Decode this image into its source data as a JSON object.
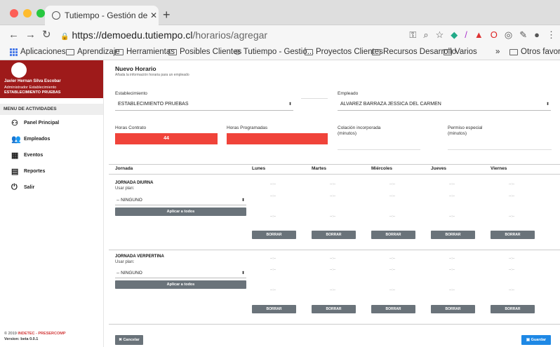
{
  "browser": {
    "tab_title": "Tutiempo - Gestión de Asistencia",
    "url_host": "https://demoedu.tutiempo.cl",
    "url_path": "/horarios/agregar",
    "bookmarks": [
      "Aplicaciones",
      "Aprendizaje",
      "Herramientas",
      "Posibles Clientes",
      "Tutiempo - Gestió...",
      "Proyectos Clientes",
      "Recursos Desarrollo",
      "Varios",
      "»",
      "Otros favoritos"
    ]
  },
  "sidebar": {
    "user_name": "Javier Hernan Silva Escobar",
    "user_role": "Administrador Establecimiento",
    "establishment": "ESTABLECIMIENTO PRUEBAS",
    "menu_header": "MENU DE ACTIVIDADES",
    "items": [
      {
        "label": "Panel Principal",
        "icon": "dashboard-icon"
      },
      {
        "label": "Empleados",
        "icon": "users-icon"
      },
      {
        "label": "Eventos",
        "icon": "calendar-icon"
      },
      {
        "label": "Reportes",
        "icon": "report-icon"
      },
      {
        "label": "Salir",
        "icon": "power-icon"
      }
    ],
    "footer_year": "© 2019",
    "footer_brand": "INDETEC - PRESERCOMP",
    "footer_version": "Version: beta 0.0.1"
  },
  "form": {
    "title": "Nuevo Horario",
    "subtitle": "Añada la información horaria para un empleado",
    "establishment_label": "Establecimiento",
    "establishment_value": "ESTABLECIMIENTO PRUEBAS",
    "employee_label": "Empleado",
    "employee_value": "ALVAREZ BARRAZA JESSICA DEL CARMEN",
    "hours_contract_label": "Horas Contrato",
    "hours_contract_value": "44",
    "hours_programmed_label": "Horas Programadas",
    "hours_programmed_value": "",
    "colacion_label": "Colación incorporada",
    "colacion_unit": "(minutos)",
    "permiso_label": "Permiso especial",
    "permiso_unit": "(minutos)"
  },
  "schedule": {
    "col_jornada": "Jornada",
    "days": [
      "Lunes",
      "Martes",
      "Miércoles",
      "Jueves",
      "Viernes"
    ],
    "time_placeholder": "--:--",
    "usar_plan": "Usar plan:",
    "plan_value": "-- NINGUNO",
    "apply_label": "Aplicar a todos",
    "delete_label": "BORRAR",
    "blocks": [
      {
        "title": "JORNADA DIURNA"
      },
      {
        "title": "JORNADA VERPERTINA"
      }
    ]
  },
  "actions": {
    "cancel": "Cancelar",
    "save": "Guardar"
  }
}
